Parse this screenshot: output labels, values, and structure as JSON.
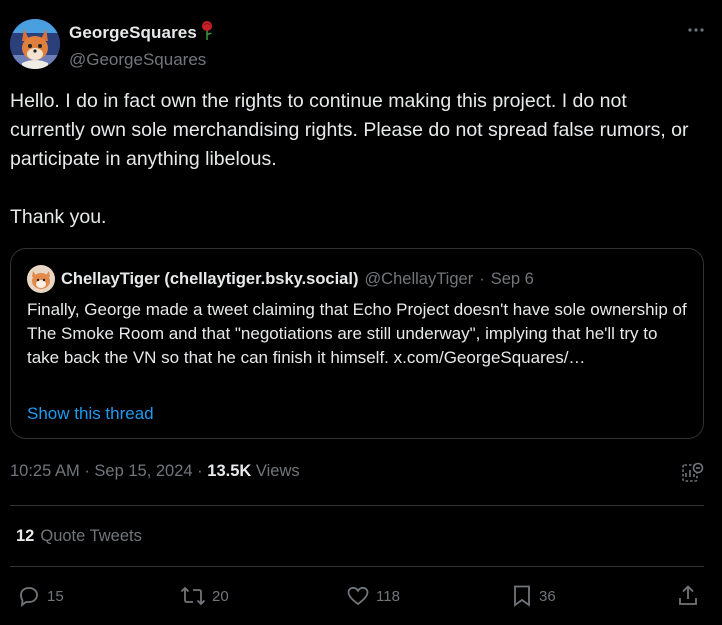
{
  "author": {
    "name": "GeorgeSquares",
    "handle": "@GeorgeSquares",
    "name_emoji": "rose-icon"
  },
  "tweet": {
    "text": "Hello. I do in fact own the rights to continue making this project. I do not currently own sole merchandising rights. Please do not spread false rumors, or participate in anything libelous.\n\nThank you."
  },
  "quote": {
    "name": "ChellayTiger (chellaytiger.bsky.social)",
    "handle": "@ChellayTiger",
    "separator": "·",
    "date": "Sep 6",
    "text": "Finally, George made a tweet claiming that Echo Project doesn't have sole ownership of The Smoke Room and that \"negotiations are still underway\", implying that he'll try to take back the VN so that he can finish it himself. x.com/GeorgeSquares/…",
    "show_thread": "Show this thread"
  },
  "meta": {
    "time": "10:25 AM",
    "sep1": "·",
    "date": "Sep 15, 2024",
    "sep2": "·",
    "views_count": "13.5K",
    "views_label": "Views"
  },
  "quote_tweets": {
    "count": "12",
    "label": "Quote Tweets"
  },
  "actions": {
    "replies": "15",
    "retweets": "20",
    "likes": "118",
    "bookmarks": "36"
  },
  "colors": {
    "background": "#000000",
    "text": "#e7e9ea",
    "secondary": "#71767b",
    "link": "#1d9bf0",
    "border": "#2f3336"
  }
}
